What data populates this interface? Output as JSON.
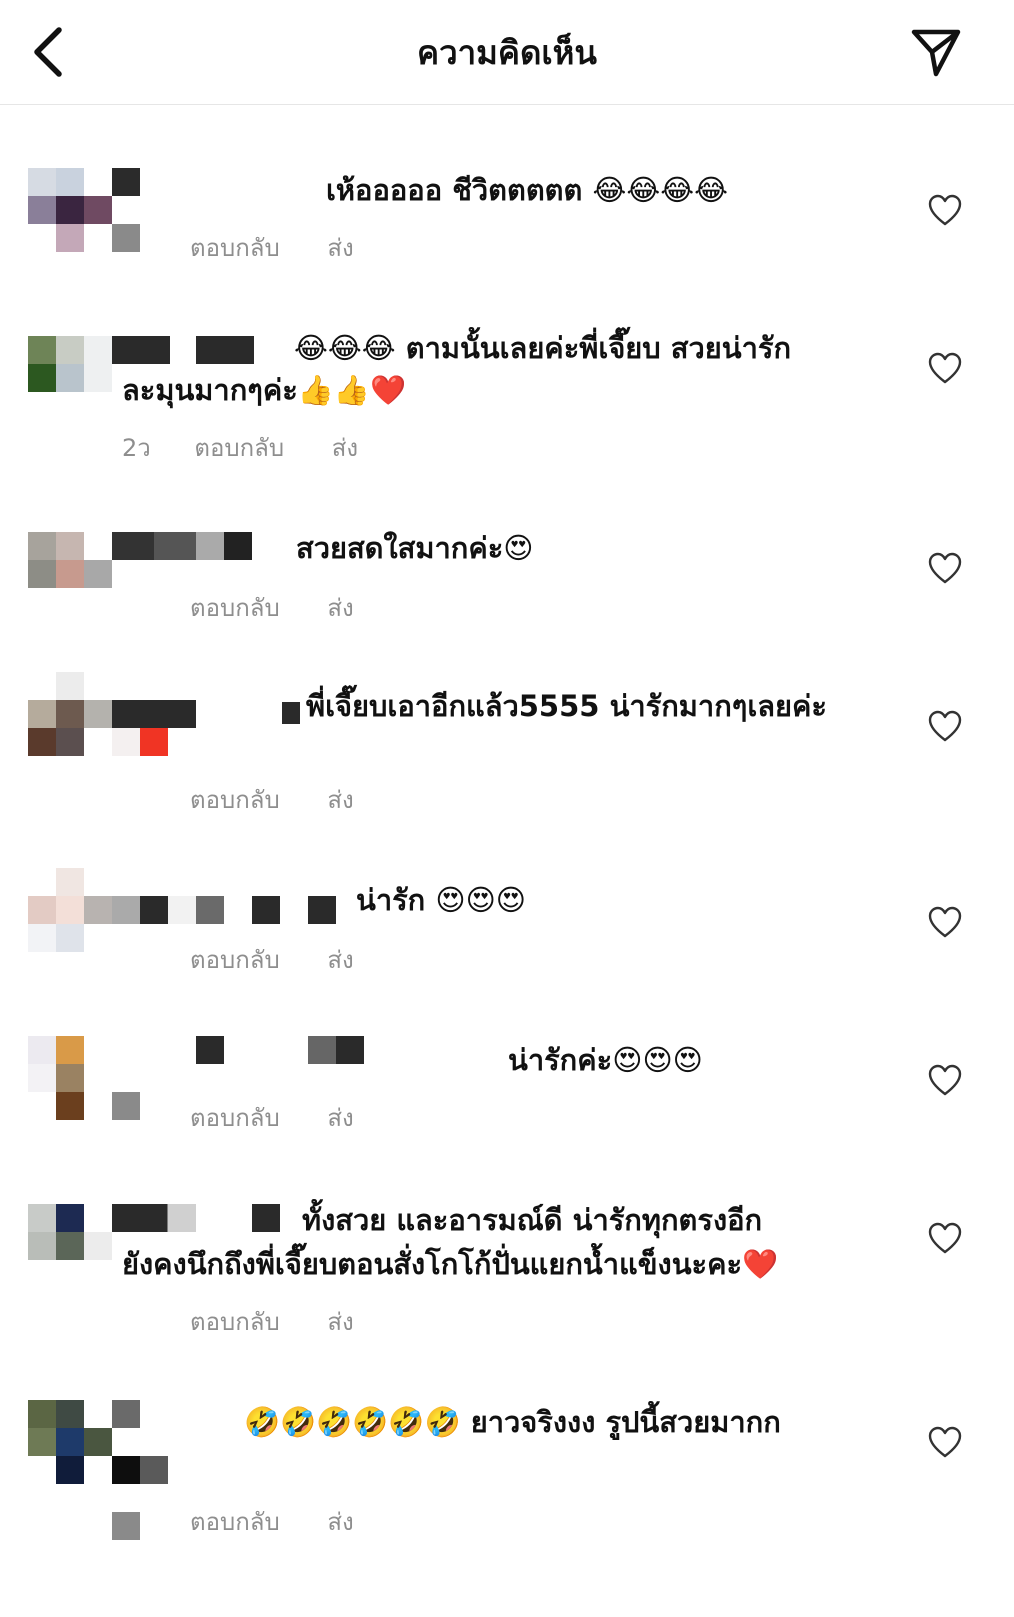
{
  "header": {
    "title": "ความคิดเห็น"
  },
  "labels": {
    "reply": "ตอบกลับ",
    "send": "ส่ง"
  },
  "comments": [
    {
      "text": "เห้อออออ ชีวิตตตตต 😂😂😂😂",
      "time": ""
    },
    {
      "text": "😂😂😂 ตามนั้นเลยค่ะพี่เจี๊ยบ สวยน่ารัก",
      "text2": "ละมุนมากๆค่ะ👍👍❤️",
      "time": "2ว"
    },
    {
      "text": "สวยสดใสมากค่ะ😍",
      "time": ""
    },
    {
      "text": "พี่เจี๊ยบเอาอีกแล้ว5555 น่ารักมากๆเลยค่ะ",
      "time": ""
    },
    {
      "text": "น่ารัก 😍😍😍",
      "time": ""
    },
    {
      "text": "น่ารักค่ะ😍😍😍",
      "time": ""
    },
    {
      "text": "ทั้งสวย และอารมณ์ดี น่ารักทุกตรงอีก",
      "text2": "ยังคงนึกถึงพี่เจี๊ยบตอนสั่งโกโก้ปั่นแยกน้ำแข็งนะคะ❤️",
      "time": ""
    },
    {
      "text": "🤣🤣🤣🤣🤣🤣 ยาวจริงงง รูปนี้สวยมากก",
      "time": ""
    }
  ]
}
